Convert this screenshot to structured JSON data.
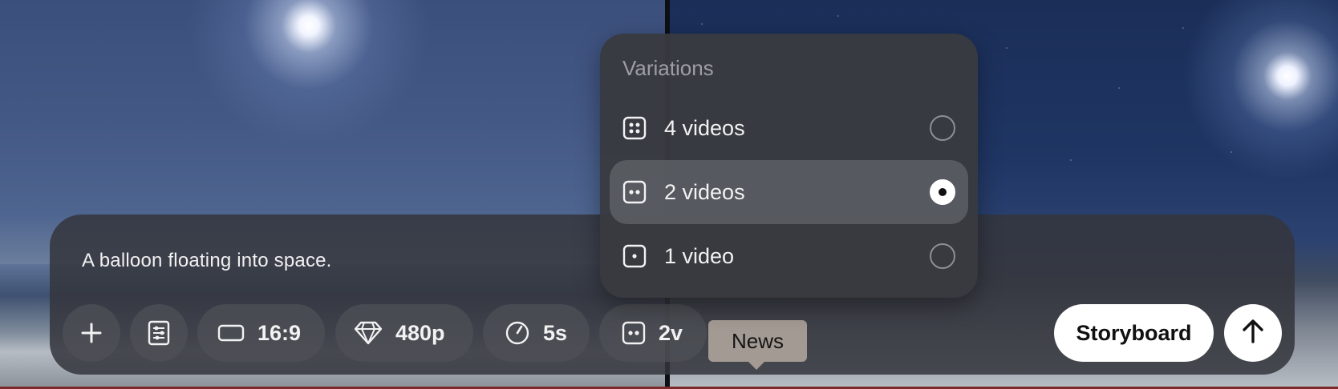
{
  "prompt": {
    "text": "A balloon floating into space."
  },
  "toolbar": {
    "aspect_ratio": "16:9",
    "resolution": "480p",
    "duration": "5s",
    "variations": "2v",
    "storyboard_label": "Storyboard"
  },
  "tooltip": {
    "text": "News"
  },
  "variations_menu": {
    "title": "Variations",
    "options": [
      {
        "label": "4 videos",
        "selected": false,
        "icon": "dice-four-icon"
      },
      {
        "label": "2 videos",
        "selected": true,
        "icon": "dice-two-icon"
      },
      {
        "label": "1 video",
        "selected": false,
        "icon": "dice-one-icon"
      }
    ]
  },
  "colors": {
    "panel": "#34363c",
    "chip": "#4e5056",
    "primary_button": "#ffffff",
    "tooltip": "#a39a93"
  }
}
